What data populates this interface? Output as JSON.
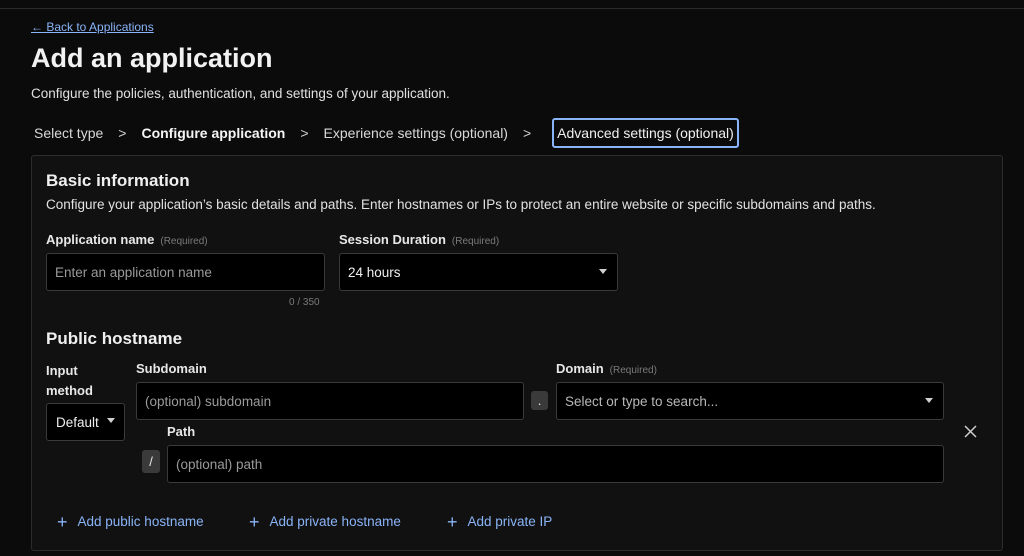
{
  "nav": {
    "back_link": "← Back to Applications"
  },
  "header": {
    "title": "Add an application",
    "subtitle": "Configure the policies, authentication, and settings of your application."
  },
  "steps": [
    {
      "label": "Select type",
      "state": "done"
    },
    {
      "label": "Configure application",
      "state": "current"
    },
    {
      "label": "Experience settings (optional)",
      "state": "pending"
    },
    {
      "label": "Advanced settings (optional)",
      "state": "focused"
    }
  ],
  "step_separator": ">",
  "basic_info": {
    "title": "Basic information",
    "description": "Configure your application’s basic details and paths. Enter hostnames or IPs to protect an entire website or specific subdomains and paths.",
    "app_name": {
      "label": "Application name",
      "required": "(Required)",
      "placeholder": "Enter an application name",
      "counter": "0 / 350"
    },
    "session_duration": {
      "label": "Session Duration",
      "required": "(Required)",
      "value": "24 hours"
    }
  },
  "public_hostname": {
    "title": "Public hostname",
    "input_method": {
      "label_line1": "Input",
      "label_line2": "method",
      "value": "Default"
    },
    "subdomain": {
      "label": "Subdomain",
      "placeholder": "(optional) subdomain"
    },
    "dot": ".",
    "domain": {
      "label": "Domain",
      "required": "(Required)",
      "placeholder": "Select or type to search..."
    },
    "path": {
      "label": "Path",
      "slash": "/",
      "placeholder": "(optional) path"
    }
  },
  "actions": {
    "plus": "+",
    "add_public_hostname": "Add public hostname",
    "add_private_hostname": "Add private hostname",
    "add_private_ip": "Add private IP"
  },
  "colors": {
    "accent": "#8ab4f8",
    "background": "#0b0b0b",
    "card": "#111111"
  }
}
